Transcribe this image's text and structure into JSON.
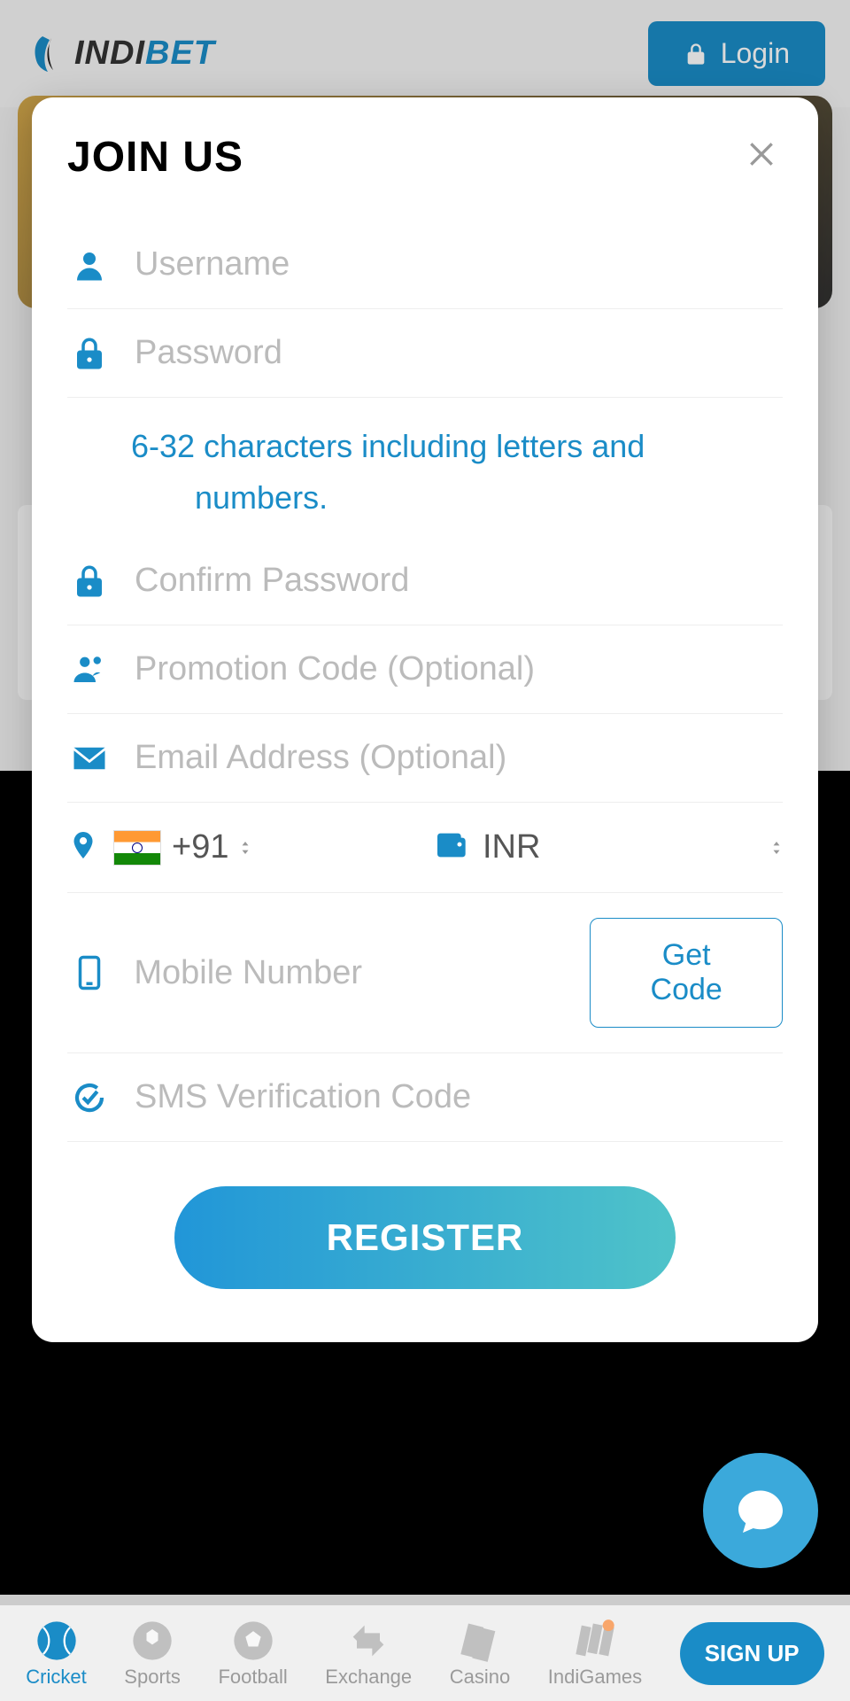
{
  "header": {
    "logo_indi": "INDI",
    "logo_bet": "BET",
    "login_label": "Login"
  },
  "modal": {
    "title": "JOIN US",
    "username_placeholder": "Username",
    "password_placeholder": "Password",
    "password_hint": "6-32 characters including letters and numbers.",
    "confirm_password_placeholder": "Confirm Password",
    "promo_placeholder": "Promotion Code (Optional)",
    "email_placeholder": "Email Address (Optional)",
    "country_code": "+91",
    "currency": "INR",
    "mobile_placeholder": "Mobile Number",
    "get_code_label": "Get Code",
    "sms_placeholder": "SMS Verification Code",
    "register_label": "REGISTER"
  },
  "bottom_nav": {
    "items": [
      {
        "label": "Cricket",
        "active": true
      },
      {
        "label": "Sports",
        "active": false
      },
      {
        "label": "Football",
        "active": false
      },
      {
        "label": "Exchange",
        "active": false
      },
      {
        "label": "Casino",
        "active": false
      },
      {
        "label": "IndiGames",
        "active": false
      }
    ],
    "signup_label": "SIGN UP"
  }
}
